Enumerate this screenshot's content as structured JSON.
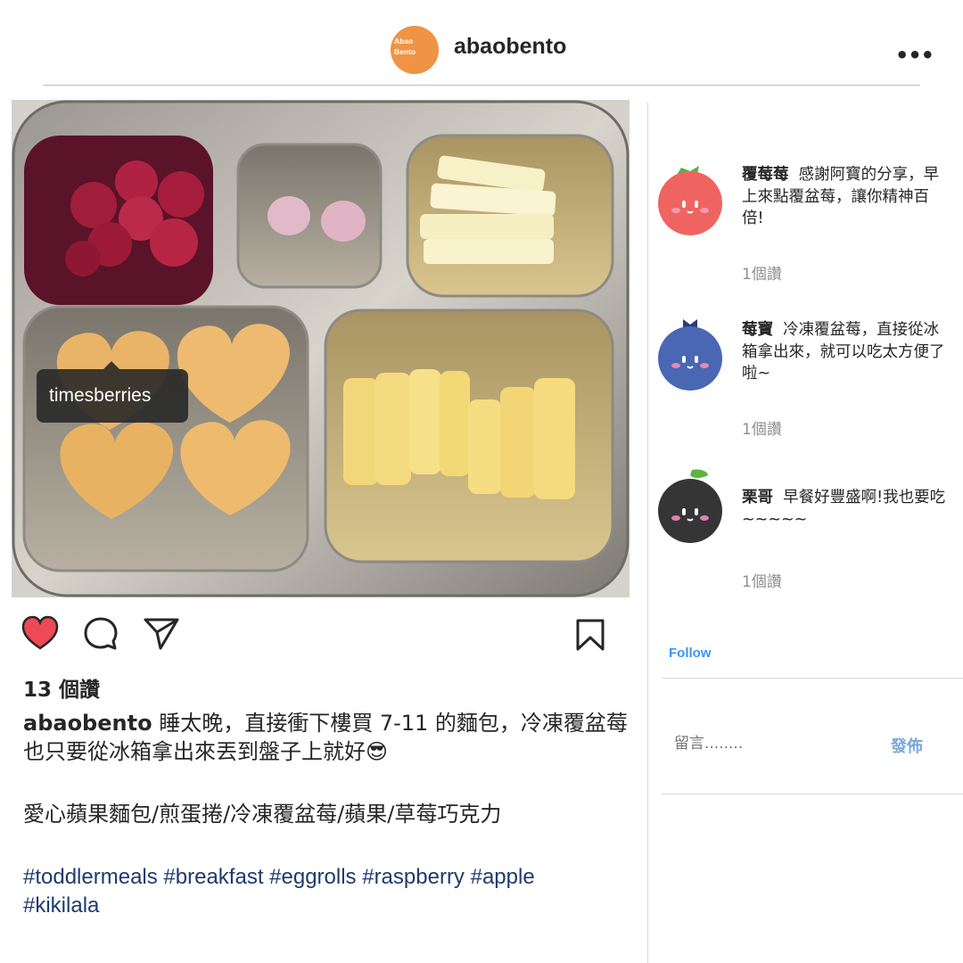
{
  "header": {
    "avatar_line1": "Abao",
    "avatar_line2": "Bento",
    "username": "abaobento",
    "more_icon": "more-horizontal-icon",
    "more_label": "•••"
  },
  "photo": {
    "tag_label": "timesberries",
    "user_tag_icon": "person-icon"
  },
  "actions": {
    "like_icon": "heart-icon",
    "like_color": "#ed4956",
    "comment_icon": "comment-icon",
    "share_icon": "paper-plane-icon",
    "save_icon": "bookmark-icon"
  },
  "post": {
    "likes": "13 個讚",
    "caption_user": "abaobento",
    "caption_text": " 睡太晚，直接衝下樓買 7-11 的麵包，冷凍覆盆莓也只要從冰箱拿出來丟到盤子上就好😎",
    "foods": "愛心蘋果麵包/煎蛋捲/冷凍覆盆莓/蘋果/草莓巧克力",
    "hashtags": "#toddlermeals #breakfast #eggrolls #raspberry #apple #kikilala",
    "hashtag_color": "#1f3a6e"
  },
  "comments": [
    {
      "user": "覆莓莓",
      "text": "感謝阿寶的分享，早上來點覆盆莓，讓你精神百倍!",
      "likes": "1個讚",
      "avatar_color": "#ef6461",
      "avatar_icon": "raspberry-face-icon"
    },
    {
      "user": "莓寶",
      "text": "冷凍覆盆莓，直接從冰箱拿出來，就可以吃太方便了啦~",
      "likes": "1個讚",
      "avatar_color": "#4a67b4",
      "avatar_icon": "blueberry-face-icon"
    },
    {
      "user": "栗哥",
      "text": "早餐好豐盛啊!我也要吃~~~~~",
      "likes": "1個讚",
      "avatar_color": "#353535",
      "avatar_icon": "blackberry-face-icon"
    }
  ],
  "sidebar": {
    "follow_label": "Follow",
    "comment_placeholder": "留言........",
    "post_label": "發佈",
    "follow_color": "#3897f0"
  }
}
